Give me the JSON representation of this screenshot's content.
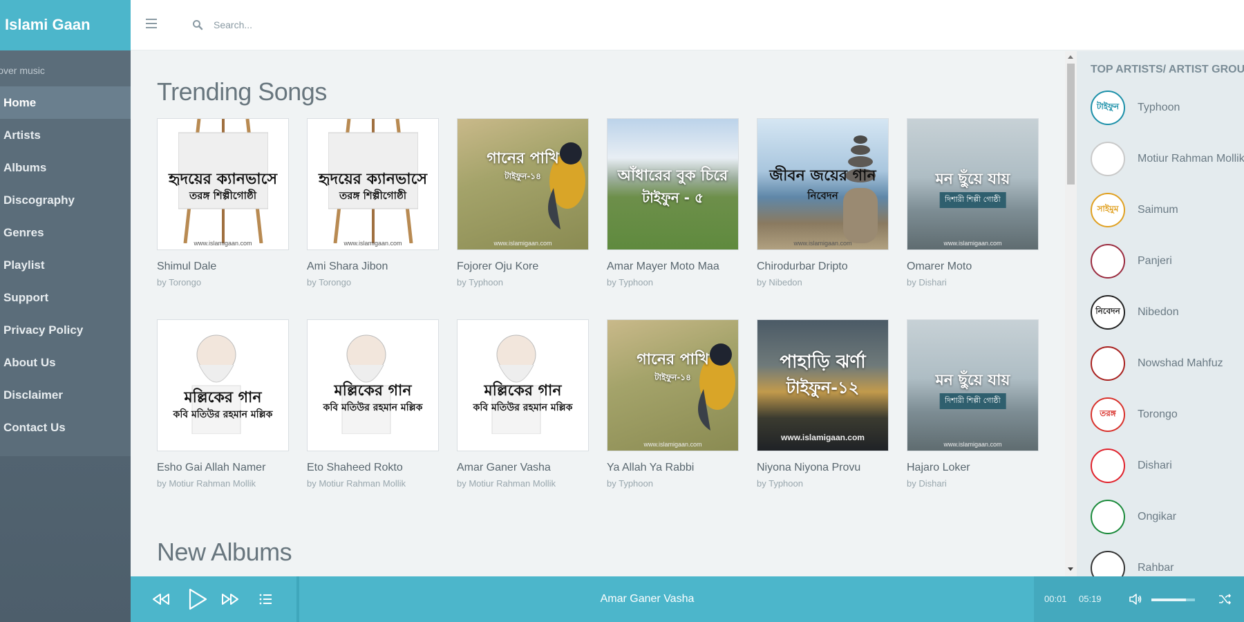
{
  "brand": {
    "title": "Islami Gaan"
  },
  "header": {
    "search_placeholder": "Search..."
  },
  "sidebar": {
    "caption": "Discover music",
    "items": [
      {
        "label": "Home",
        "active": true
      },
      {
        "label": "Artists"
      },
      {
        "label": "Albums"
      },
      {
        "label": "Discography"
      },
      {
        "label": "Genres"
      },
      {
        "label": "Playlist"
      },
      {
        "label": "Support"
      },
      {
        "label": "Privacy Policy"
      },
      {
        "label": "About Us"
      },
      {
        "label": "Disclaimer"
      },
      {
        "label": "Contact Us"
      }
    ]
  },
  "main": {
    "trending_title": "Trending Songs",
    "new_albums_title": "New Albums",
    "trending": [
      {
        "title": "Shimul Dale",
        "artist": "by Torongo",
        "cover_line1": "হৃদয়ের ক্যানভাসে",
        "cover_line2": "তরঙ্গ শিল্পীগোষ্ঠী"
      },
      {
        "title": "Ami Shara Jibon",
        "artist": "by Torongo",
        "cover_line1": "হৃদয়ের ক্যানভাসে",
        "cover_line2": "তরঙ্গ শিল্পীগোষ্ঠী"
      },
      {
        "title": "Fojorer Oju Kore",
        "artist": "by Typhoon",
        "cover_line1": "গানের পাখি",
        "cover_line2": "টাইফুন-১৪"
      },
      {
        "title": "Amar Mayer Moto Maa",
        "artist": "by Typhoon",
        "cover_line1": "আঁধারের বুক চিরে",
        "cover_line2": "টাইফুন - ৫"
      },
      {
        "title": "Chirodurbar Dripto",
        "artist": "by Nibedon",
        "cover_line1": "জীবন জয়ের গান",
        "cover_line2": "নিবেদন"
      },
      {
        "title": "Omarer Moto",
        "artist": "by Dishari",
        "cover_line1": "মন ছুঁয়ে যায়",
        "cover_line2": "দিশারী শিল্পী গোষ্ঠী"
      },
      {
        "title": "Esho Gai Allah Namer",
        "artist": "by Motiur Rahman Mollik",
        "cover_line1": "মল্লিকের গান",
        "cover_line2": "কবি মতিউর রহমান মল্লিক"
      },
      {
        "title": "Eto Shaheed Rokto",
        "artist": "by Motiur Rahman Mollik",
        "cover_line1": "মল্লিকের গান",
        "cover_line2": "কবি মতিউর রহমান মল্লিক"
      },
      {
        "title": "Amar Ganer Vasha",
        "artist": "by Motiur Rahman Mollik",
        "cover_line1": "মল্লিকের গান",
        "cover_line2": "কবি মতিউর রহমান মল্লিক"
      },
      {
        "title": "Ya Allah Ya Rabbi",
        "artist": "by Typhoon",
        "cover_line1": "গানের পাখি",
        "cover_line2": "টাইফুন-১৪"
      },
      {
        "title": "Niyona Niyona Provu",
        "artist": "by Typhoon",
        "cover_line1": "পাহাড়ি ঝর্ণা",
        "cover_line2": "টাইফুন-১২"
      },
      {
        "title": "Hajaro Loker",
        "artist": "by Dishari",
        "cover_line1": "মন ছুঁয়ে যায়",
        "cover_line2": "দিশারী শিল্পী গোষ্ঠী"
      }
    ],
    "watermark": "www.islamigaan.com"
  },
  "aside": {
    "title": "TOP ARTISTS/ ARTIST GROUPS",
    "artists": [
      {
        "name": "Typhoon",
        "logo": "টাইফুন",
        "color": "#1a8fa8"
      },
      {
        "name": "Motiur Rahman Mollik",
        "logo": "",
        "color": "#c9c9c9"
      },
      {
        "name": "Saimum",
        "logo": "সাইমুম",
        "color": "#e0a020"
      },
      {
        "name": "Panjeri",
        "logo": "",
        "color": "#9a2a3e"
      },
      {
        "name": "Nibedon",
        "logo": "নিবেদন",
        "color": "#222222"
      },
      {
        "name": "Nowshad Mahfuz",
        "logo": "",
        "color": "#a8201e"
      },
      {
        "name": "Torongo",
        "logo": "তরঙ্গ",
        "color": "#d8302a"
      },
      {
        "name": "Dishari",
        "logo": "",
        "color": "#e0202a"
      },
      {
        "name": "Ongikar",
        "logo": "",
        "color": "#1a8a3a"
      },
      {
        "name": "Rahbar",
        "logo": "",
        "color": "#333333"
      }
    ]
  },
  "player": {
    "now_playing": "Amar Ganer Vasha",
    "current_time": "00:01",
    "duration": "05:19",
    "volume_fraction": 0.8,
    "accent": "#4cb6cb"
  }
}
